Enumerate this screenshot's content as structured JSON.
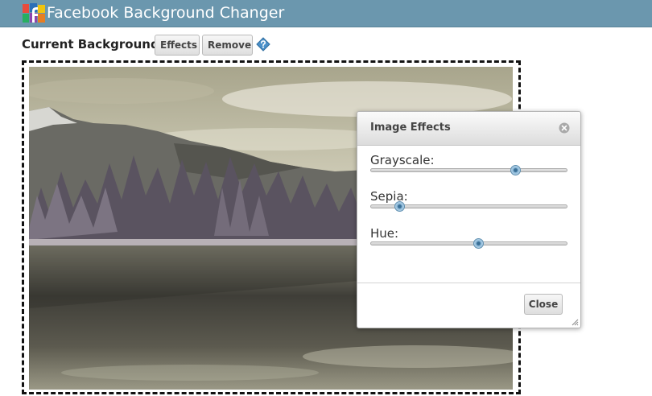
{
  "app": {
    "title": "Facebook Background Changer"
  },
  "background": {
    "section_title": "Current Background",
    "effects_label": "Effects",
    "remove_label": "Remove"
  },
  "dialog": {
    "title": "Image Effects",
    "sliders": [
      {
        "label": "Grayscale:",
        "value": 0.74
      },
      {
        "label": "Sepia:",
        "value": 0.15
      },
      {
        "label": "Hue:",
        "value": 0.55
      }
    ],
    "close_label": "Close"
  },
  "colors": {
    "topbar": "#6b97ae",
    "slider_handle": "#8cb9d9"
  },
  "icons": {
    "logo": "facebook-logo-icon",
    "help": "help-icon",
    "dialog_close": "close-icon"
  }
}
